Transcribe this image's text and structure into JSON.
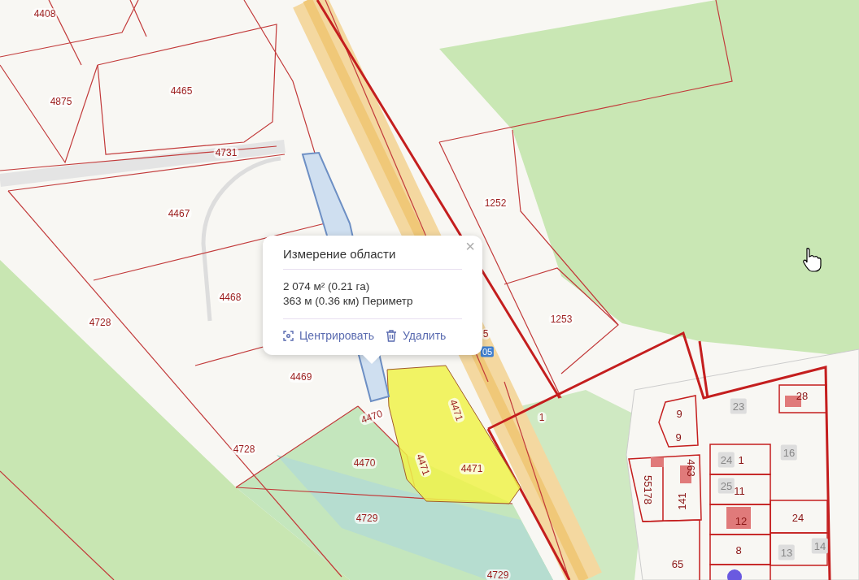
{
  "map": {
    "labels": [
      {
        "text": "4408",
        "kind": "parcel"
      },
      {
        "text": "4875",
        "kind": "parcel"
      },
      {
        "text": "4465",
        "kind": "parcel"
      },
      {
        "text": "4731",
        "kind": "parcel"
      },
      {
        "text": "4467",
        "kind": "parcel"
      },
      {
        "text": "4468",
        "kind": "parcel"
      },
      {
        "text": "4728",
        "kind": "parcel"
      },
      {
        "text": "4469",
        "kind": "parcel"
      },
      {
        "text": "4470",
        "kind": "parcel"
      },
      {
        "text": "4728",
        "kind": "parcel"
      },
      {
        "text": "4470",
        "kind": "parcel"
      },
      {
        "text": "4729",
        "kind": "parcel"
      },
      {
        "text": "4729",
        "kind": "parcel"
      },
      {
        "text": "4471",
        "kind": "parcel"
      },
      {
        "text": "4471",
        "kind": "parcel"
      },
      {
        "text": "4471",
        "kind": "parcel"
      },
      {
        "text": "1252",
        "kind": "parcel"
      },
      {
        "text": "1253",
        "kind": "parcel"
      },
      {
        "text": "1",
        "kind": "parcel"
      },
      {
        "text": "5",
        "kind": "parcel"
      },
      {
        "text": "05",
        "kind": "route"
      },
      {
        "text": "28",
        "kind": "parcel"
      },
      {
        "text": "9",
        "kind": "parcel"
      },
      {
        "text": "9",
        "kind": "parcel"
      },
      {
        "text": "23",
        "kind": "building"
      },
      {
        "text": "16",
        "kind": "building"
      },
      {
        "text": "24",
        "kind": "building"
      },
      {
        "text": "1",
        "kind": "parcel"
      },
      {
        "text": "463",
        "kind": "parcel"
      },
      {
        "text": "55178",
        "kind": "parcel"
      },
      {
        "text": "25",
        "kind": "building"
      },
      {
        "text": "11",
        "kind": "parcel"
      },
      {
        "text": "141",
        "kind": "parcel"
      },
      {
        "text": "12",
        "kind": "parcel"
      },
      {
        "text": "24",
        "kind": "parcel"
      },
      {
        "text": "8",
        "kind": "parcel"
      },
      {
        "text": "13",
        "kind": "building"
      },
      {
        "text": "14",
        "kind": "building"
      },
      {
        "text": "65",
        "kind": "parcel"
      }
    ]
  },
  "popup": {
    "title": "Измерение области",
    "area": "2 074 м² (0.21 га)",
    "perimeter": "363 м (0.36 км) Периметр",
    "close": "×",
    "actions": [
      {
        "label": "Центрировать",
        "kind": "center"
      },
      {
        "label": "Удалить",
        "kind": "delete"
      }
    ]
  }
}
